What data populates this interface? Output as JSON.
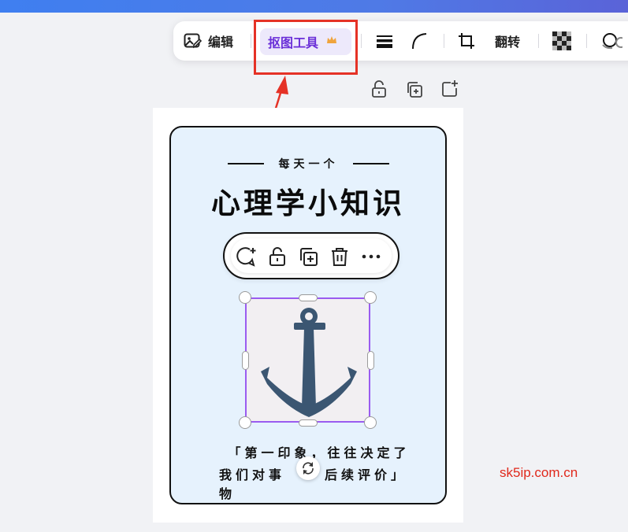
{
  "toolbar": {
    "edit_label": "编辑",
    "cutout_label": "抠图工具",
    "flip_label": "翻转",
    "icons": [
      "image-edit-icon",
      "crown-icon",
      "line-weight-icon",
      "corner-radius-icon",
      "crop-icon",
      "transparency-icon",
      "effects-icon"
    ]
  },
  "float_icons": [
    "lock-icon",
    "duplicate-icon",
    "add-page-icon"
  ],
  "card": {
    "subtitle": "每天一个",
    "title": "心理学小知识",
    "quote_line1": "「第一印象，往往决定了",
    "quote_line2_left": "我们对事物",
    "quote_line2_right": "后续评价」"
  },
  "context_menu": {
    "icons": [
      "comment-add-icon",
      "unlock-icon",
      "duplicate-icon",
      "delete-icon",
      "more-icon"
    ]
  },
  "selected_element": "anchor-image",
  "colors": {
    "accent": "#6a2fd8",
    "selection": "#9a5cf0",
    "annotation_red": "#e53226",
    "card_bg": "#e6f2fd",
    "anchor": "#3b5672"
  },
  "watermark": "sk5ip.com.cn"
}
